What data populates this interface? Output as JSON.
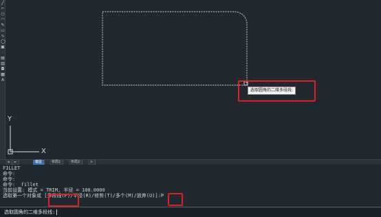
{
  "tooltip": {
    "text": "选取圆角的二维多段线:"
  },
  "ucs": {
    "x_label": "X",
    "y_label": "Y"
  },
  "tabs": [
    {
      "label": "◂"
    },
    {
      "label": "▸"
    },
    {
      "label": "模型",
      "active": true
    },
    {
      "label": "布局1"
    },
    {
      "label": "布局2"
    },
    {
      "label": "+"
    }
  ],
  "history": {
    "lines": [
      "FILLET",
      "命令:",
      "命令:",
      "命令: _fillet",
      "当前设置: 模式 = TRIM, 半径 = 100.0000",
      "选取第一个对象或 [多段线(P)/半径(R)/修剪(T)/多个(M)/放弃(U)]:P"
    ]
  },
  "command_line": {
    "prompt": "选取圆角的二维多段线:"
  },
  "colors": {
    "background": "#212830",
    "highlight": "#e02020",
    "geometry": "#d8dde3"
  },
  "toolbar": {
    "icons": [
      "line-icon",
      "polyline-icon",
      "circle-icon",
      "arc-icon",
      "pen-icon",
      "rectangle-icon",
      "spline-icon",
      "ellipse-icon",
      "block-icon",
      "point-icon",
      "hatch-icon",
      "gradient-icon",
      "region-icon",
      "table-icon",
      "text-icon"
    ]
  }
}
